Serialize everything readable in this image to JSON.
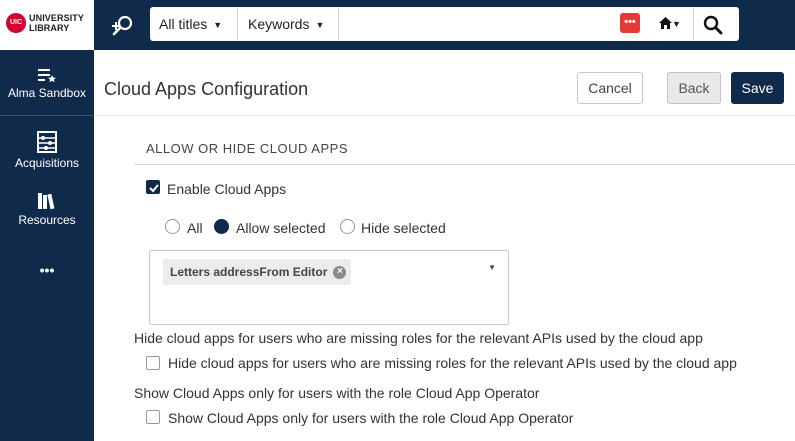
{
  "header_bar": {
    "logo": {
      "badge": "UIC",
      "line1": "UNIVERSITY",
      "line2": "LIBRARY"
    },
    "search": {
      "scope": "All titles",
      "field": "Keywords",
      "extension_badge": "•••"
    }
  },
  "sidebar": {
    "items": [
      {
        "label": "Alma Sandbox",
        "icon": "list-star-icon"
      },
      {
        "label": "Acquisitions",
        "icon": "abacus-icon"
      },
      {
        "label": "Resources",
        "icon": "books-icon"
      },
      {
        "label": "•••",
        "icon": "more-icon"
      }
    ]
  },
  "page": {
    "title": "Cloud Apps Configuration",
    "buttons": {
      "cancel": "Cancel",
      "back": "Back",
      "save": "Save"
    }
  },
  "section": {
    "title": "ALLOW OR HIDE CLOUD APPS",
    "enable_label": "Enable Cloud Apps",
    "enable_checked": true,
    "radios": [
      {
        "label": "All",
        "checked": false
      },
      {
        "label": "Allow selected",
        "checked": true
      },
      {
        "label": "Hide selected",
        "checked": false
      }
    ],
    "selected_apps": [
      "Letters addressFrom Editor"
    ],
    "missing_roles_heading": "Hide cloud apps for users who are missing roles for the relevant APIs used by the cloud app",
    "missing_roles_label": "Hide cloud apps for users who are missing roles for the relevant APIs used by the cloud app",
    "missing_roles_checked": false,
    "operator_heading": "Show Cloud Apps only for users with the role Cloud App Operator",
    "operator_label": "Show Cloud Apps only for users with the role Cloud App Operator",
    "operator_checked": false
  },
  "colors": {
    "navy": "#0f2a4a",
    "ext_red": "#e53935",
    "brand_red": "#d50032"
  }
}
